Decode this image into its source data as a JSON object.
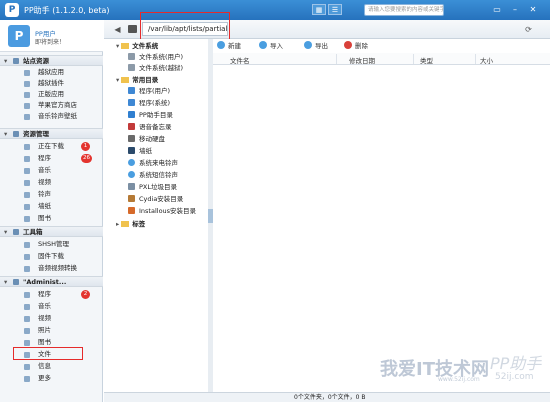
{
  "window": {
    "title": "PP助手 (1.1.2.0, beta)",
    "logo": "P",
    "view_buttons": [
      "grid-view-icon",
      "list-view-icon"
    ],
    "controls": [
      "restore-icon",
      "minimize-icon",
      "close-icon"
    ]
  },
  "search": {
    "placeholder": "请输入您要搜索的内容或关键字"
  },
  "profile": {
    "name": "PP用户",
    "status": "即将到来！"
  },
  "sidebar": {
    "sections": [
      {
        "label": "站点资源",
        "items": [
          {
            "label": "越狱应用"
          },
          {
            "label": "越狱插件"
          },
          {
            "label": "正版应用"
          },
          {
            "label": "苹果官方商店"
          },
          {
            "label": "音乐铃声壁纸"
          }
        ]
      },
      {
        "label": "资源管理",
        "items": [
          {
            "label": "正在下载",
            "badge": "1"
          },
          {
            "label": "程序",
            "badge": "26"
          },
          {
            "label": "音乐"
          },
          {
            "label": "视频"
          },
          {
            "label": "铃声"
          },
          {
            "label": "墙纸"
          },
          {
            "label": "图书"
          }
        ]
      },
      {
        "label": "工具箱",
        "items": [
          {
            "label": "SHSH管理"
          },
          {
            "label": "固件下载"
          },
          {
            "label": "音频视频转换"
          }
        ]
      },
      {
        "label": "\"Administ...",
        "items": [
          {
            "label": "程序",
            "badge": "2"
          },
          {
            "label": "音乐"
          },
          {
            "label": "视频"
          },
          {
            "label": "照片"
          },
          {
            "label": "图书"
          },
          {
            "label": "文件"
          },
          {
            "label": "信息"
          },
          {
            "label": "更多"
          }
        ]
      }
    ]
  },
  "path": {
    "value": "/var/lib/apt/lists/partial"
  },
  "tree": {
    "groups": [
      {
        "label": "文件系统",
        "items": [
          {
            "label": "文件系统(用户)"
          },
          {
            "label": "文件系统(越狱)"
          }
        ]
      },
      {
        "label": "常用目录",
        "items": [
          {
            "label": "程序(用户)"
          },
          {
            "label": "程序(系统)"
          },
          {
            "label": "PP助手目录"
          },
          {
            "label": "语音备忘录"
          },
          {
            "label": "移动硬盘"
          },
          {
            "label": "墙纸"
          },
          {
            "label": "系统来电铃声"
          },
          {
            "label": "系统短信铃声"
          },
          {
            "label": "PXL垃圾目录"
          },
          {
            "label": "Cydia安装目录"
          },
          {
            "label": "Installous安装目录"
          }
        ]
      },
      {
        "label": "标签",
        "items": []
      }
    ]
  },
  "actions": [
    {
      "label": "新建"
    },
    {
      "label": "导入"
    },
    {
      "label": "导出"
    },
    {
      "label": "删除"
    }
  ],
  "columns": [
    "文件名",
    "修改日期",
    "类型",
    "大小"
  ],
  "status_text": "0个文件夹，0个文件，0 B",
  "watermark": {
    "main": "我爱IT技术网",
    "sub": "www.52ij.com",
    "brand": "PP助手",
    "url": "52ij.com"
  },
  "colors": {
    "accent": "#2672bd",
    "badge": "#e3342f",
    "highlight": "#e52b2b"
  }
}
